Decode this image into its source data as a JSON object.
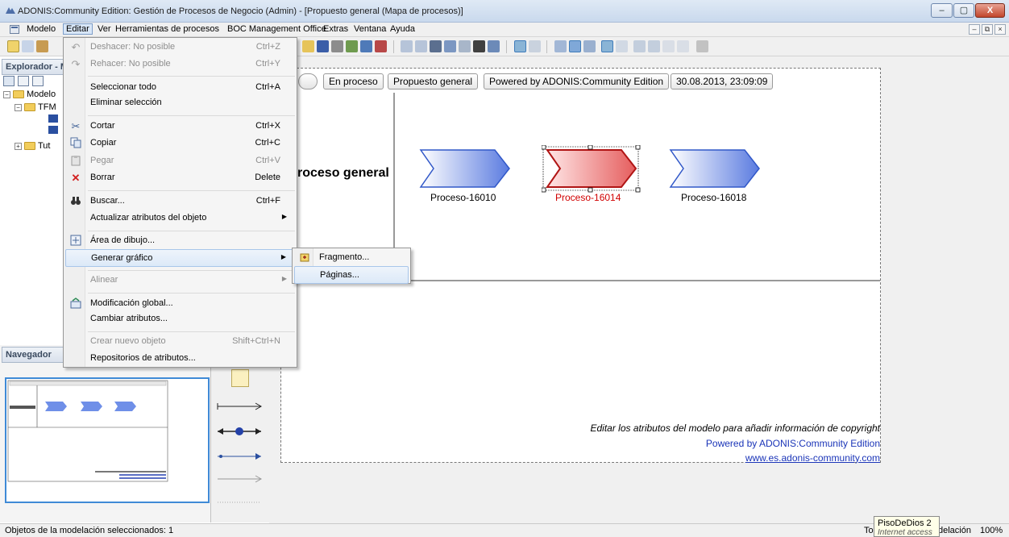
{
  "window": {
    "title": "ADONIS:Community Edition: Gestión de Procesos de Negocio (Admin) - [Propuesto general (Mapa de procesos)]",
    "min_label": "–",
    "max_label": "▢",
    "close_label": "X"
  },
  "menubar": {
    "items": [
      "Modelo",
      "Editar",
      "Ver",
      "Herramientas de procesos",
      "BOC Management Office",
      "Extras",
      "Ventana",
      "Ayuda"
    ],
    "mdi_min": "–",
    "mdi_restore": "⧉",
    "mdi_close": "×"
  },
  "explorer": {
    "title": "Explorador - M",
    "tree": {
      "root": "Modelo",
      "child1": "TFM",
      "child2": "Tut"
    }
  },
  "navigator": {
    "title": "Navegador"
  },
  "edit_menu": {
    "items": [
      {
        "label": "Deshacer: No posible",
        "shortcut": "Ctrl+Z",
        "disabled": true,
        "icon": "undo-icon"
      },
      {
        "label": "Rehacer: No posible",
        "shortcut": "Ctrl+Y",
        "disabled": true,
        "icon": "redo-icon"
      },
      {
        "label": "Seleccionar todo",
        "shortcut": "Ctrl+A"
      },
      {
        "label": "Eliminar selección",
        "shortcut": ""
      },
      {
        "label": "Cortar",
        "shortcut": "Ctrl+X",
        "icon": "scissors-icon"
      },
      {
        "label": "Copiar",
        "shortcut": "Ctrl+C",
        "icon": "copy-icon"
      },
      {
        "label": "Pegar",
        "shortcut": "Ctrl+V",
        "disabled": true,
        "icon": "paste-icon"
      },
      {
        "label": "Borrar",
        "shortcut": "Delete",
        "icon": "delete-icon"
      },
      {
        "label": "Buscar...",
        "shortcut": "Ctrl+F",
        "icon": "binoculars-icon"
      },
      {
        "label": "Actualizar atributos del objeto",
        "shortcut": ""
      },
      {
        "label": "Área de dibujo...",
        "shortcut": "",
        "icon": "drawing-area-icon"
      },
      {
        "label": "Generar gráfico",
        "shortcut": ""
      },
      {
        "label": "Alinear",
        "shortcut": "",
        "disabled": true
      },
      {
        "label": "Modificación global...",
        "shortcut": "",
        "icon": "global-modify-icon"
      },
      {
        "label": "Cambiar atributos...",
        "shortcut": ""
      },
      {
        "label": "Crear nuevo objeto",
        "shortcut": "Shift+Ctrl+N",
        "disabled": true
      },
      {
        "label": "Repositorios de atributos...",
        "shortcut": ""
      }
    ]
  },
  "submenu": {
    "items": [
      "Fragmento...",
      "Páginas..."
    ]
  },
  "model_header": {
    "cells": [
      "En proceso",
      "Propuesto general",
      "Powered by ADONIS:Community Edition",
      "30.08.2013, 23:09:09"
    ]
  },
  "model": {
    "lane_title": "roceso general",
    "processes": [
      "Proceso-16010",
      "Proceso-16014",
      "Proceso-16018"
    ],
    "footer_copyright": "Editar los atributos del modelo para añadir información de copyright",
    "footer_powered": "Powered by ADONIS:Community Edition",
    "footer_url": "www.es.adonis-community.com"
  },
  "statusbar": {
    "left": "Objetos de la modelación seleccionados: 1",
    "right_part1": "Todos l",
    "right_part2": "delación",
    "zoom": "100%"
  },
  "tooltip": {
    "title": "PisoDeDios 2",
    "subtitle": "Internet access"
  },
  "colors": {
    "process_blue": "#6f8fe8",
    "process_selected": "#e55d5d",
    "selected_text": "#d10000",
    "link_blue": "#1b35b8"
  }
}
